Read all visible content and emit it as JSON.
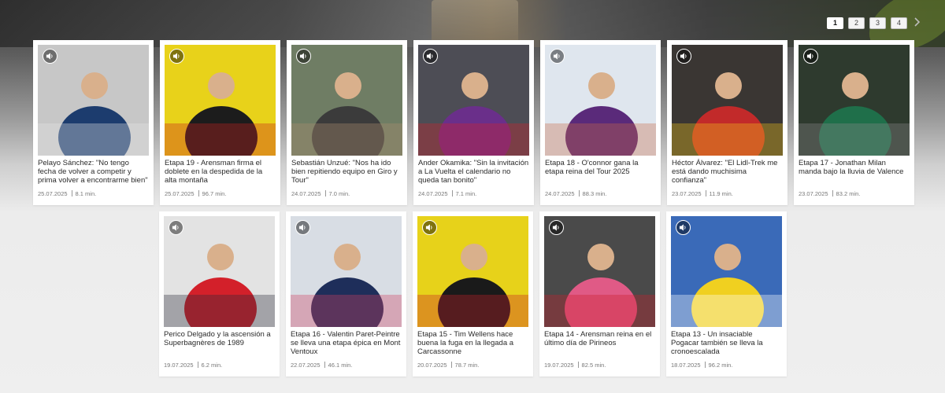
{
  "pagination": {
    "pages": [
      "1",
      "2",
      "3",
      "4"
    ],
    "active": "1"
  },
  "articles": [
    {
      "title": "Pelayo Sánchez: \"No tengo fecha de volver a competir y prima volver a encontrarme bien\"",
      "date": "25.07.2025",
      "duration": "8.1 min.",
      "colors": [
        "#c7c7c7",
        "#1c3c6e",
        "#e6e6e6"
      ]
    },
    {
      "title": "Etapa 19 - Arensman firma el doblete en la despedida de la alta montaña",
      "date": "25.07.2025",
      "duration": "96.7 min.",
      "colors": [
        "#e8d21a",
        "#1c1c1c",
        "#c8211f"
      ]
    },
    {
      "title": "Sebastián Unzué: \"Nos ha ido bien repitiendo equipo en Giro y Tour\"",
      "date": "24.07.2025",
      "duration": "7.0 min.",
      "colors": [
        "#6f7d64",
        "#3b3b3b",
        "#b09070"
      ]
    },
    {
      "title": "Ander Okamika: \"Sin la invitación a La Vuelta el calendario no queda tan bonito\"",
      "date": "24.07.2025",
      "duration": "7.1 min.",
      "colors": [
        "#4d4d55",
        "#6a2f8a",
        "#d2232a"
      ]
    },
    {
      "title": "Etapa 18 - O'connor gana la etapa reina del Tour 2025",
      "date": "24.07.2025",
      "duration": "88.3 min.",
      "colors": [
        "#dfe6ee",
        "#5a2a7a",
        "#c86a48"
      ]
    },
    {
      "title": "Héctor Álvarez: \"El Lidl-Trek me está dando muchisima confianza\"",
      "date": "23.07.2025",
      "duration": "11.9 min.",
      "colors": [
        "#3a3633",
        "#c22a2a",
        "#f0c419"
      ]
    },
    {
      "title": "Etapa 17 - Jonathan Milan manda bajo la lluvia de Valence",
      "date": "23.07.2025",
      "duration": "83.2 min.",
      "colors": [
        "#2e3a2e",
        "#1f6f4a",
        "#8a8a8a"
      ]
    },
    {
      "title": "Perico Delgado y la ascensión a Superbagnères de 1989",
      "date": "19.07.2025",
      "duration": "6.2 min.",
      "colors": [
        "#e3e3e3",
        "#d3202a",
        "#2a2a3a"
      ]
    },
    {
      "title": "Etapa 16 - Valentin Paret-Peintre se lleva una etapa épica en Mont Ventoux",
      "date": "22.07.2025",
      "duration": "46.1 min.",
      "colors": [
        "#d8dde4",
        "#1e2e5a",
        "#d04060"
      ]
    },
    {
      "title": "Etapa 15 - Tim Wellens hace buena la fuga en la llegada a Carcassonne",
      "date": "20.07.2025",
      "duration": "78.7 min.",
      "colors": [
        "#e7d21a",
        "#1a1a1a",
        "#c8222a"
      ]
    },
    {
      "title": "Etapa 14 - Arensman reina en el último día de Pirineos",
      "date": "19.07.2025",
      "duration": "82.5 min.",
      "colors": [
        "#4a4a4a",
        "#e05a86",
        "#c8202a"
      ]
    },
    {
      "title": "Etapa 13 - Un insaciable Pogacar también se lleva la cronoescalada",
      "date": "18.07.2025",
      "duration": "96.2 min.",
      "colors": [
        "#3a6ab8",
        "#f0d020",
        "#ffffff"
      ]
    }
  ]
}
